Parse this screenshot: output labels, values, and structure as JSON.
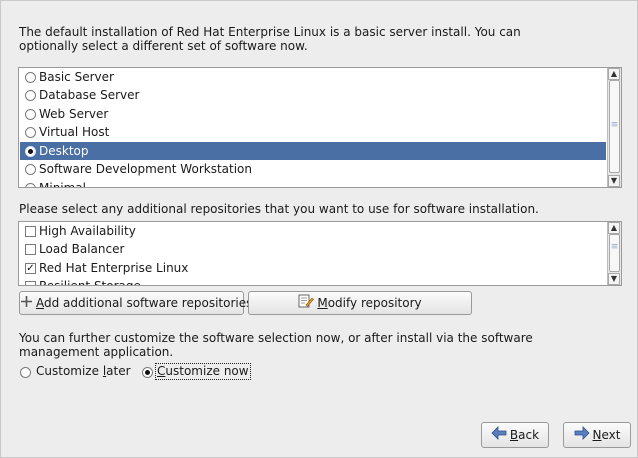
{
  "intro_text": {
    "line1": "The default installation of Red Hat Enterprise Linux is a basic server install. You can",
    "line2": "optionally select a different set of software now."
  },
  "software_sets": {
    "items": [
      {
        "label": "Basic Server",
        "selected": false
      },
      {
        "label": "Database Server",
        "selected": false
      },
      {
        "label": "Web Server",
        "selected": false
      },
      {
        "label": "Virtual Host",
        "selected": false
      },
      {
        "label": "Desktop",
        "selected": true
      },
      {
        "label": "Software Development Workstation",
        "selected": false
      },
      {
        "label": "Minimal",
        "selected": false
      }
    ]
  },
  "repos_text": "Please select any additional repositories that you want to use for software installation.",
  "repositories": {
    "items": [
      {
        "label": "High Availability",
        "checked": false
      },
      {
        "label": "Load Balancer",
        "checked": false
      },
      {
        "label": "Red Hat Enterprise Linux",
        "checked": true
      },
      {
        "label": "Resilient Storage",
        "checked": false
      }
    ]
  },
  "buttons": {
    "add_repo_prefix": "A",
    "add_repo_rest": "dd additional software repositories",
    "modify_repo_prefix": "M",
    "modify_repo_rest": "odify repository",
    "back_prefix": "B",
    "back_rest": "ack",
    "next_prefix": "N",
    "next_rest": "ext"
  },
  "customize_text": {
    "line1": "You can further customize the software selection now, or after install via the software",
    "line2": "management application."
  },
  "customize_options": {
    "later_prefix": "Customize ",
    "later_key": "l",
    "later_rest": "ater",
    "now_key": "C",
    "now_rest": "ustomize now",
    "selected": "now"
  },
  "colors": {
    "selection": "#4a6fa5",
    "background": "#ededed"
  }
}
